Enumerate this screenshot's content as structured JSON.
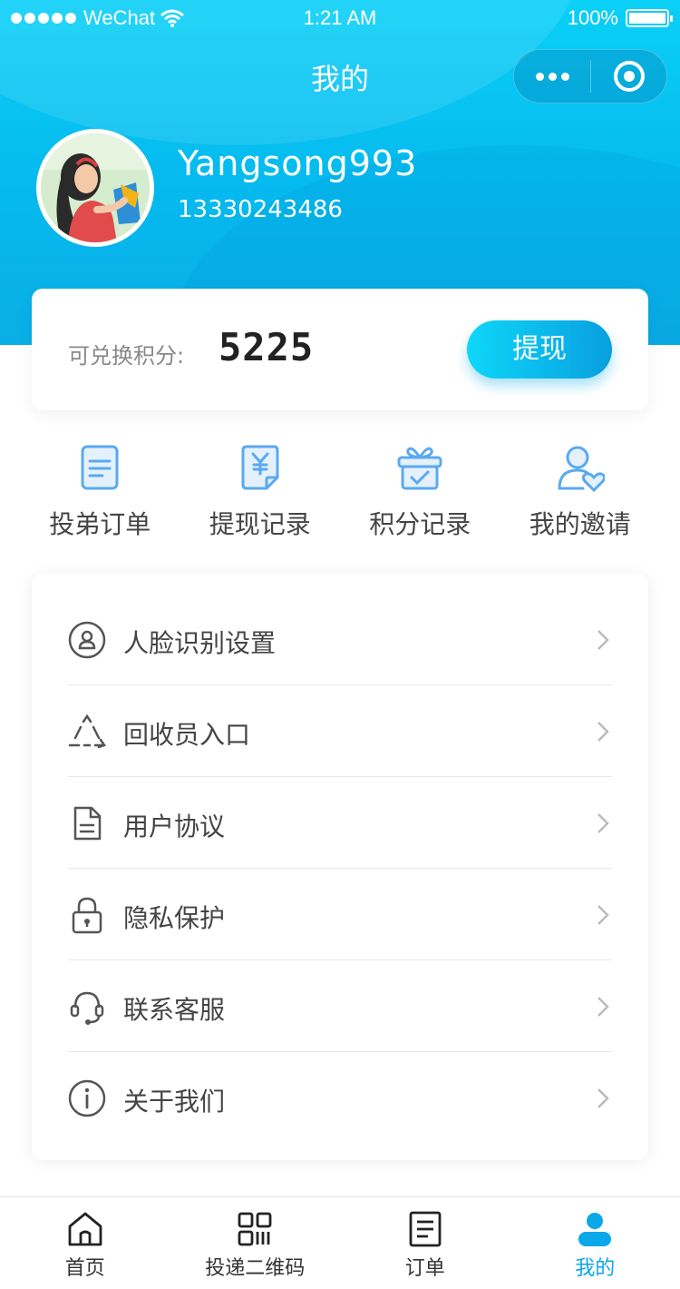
{
  "status_bar": {
    "carrier": "WeChat",
    "time": "1:21 AM",
    "battery": "100%"
  },
  "nav": {
    "title": "我的"
  },
  "profile": {
    "username": "Yangsong993",
    "phone": "13330243486"
  },
  "points": {
    "label": "可兑换积分:",
    "value": "5225",
    "button_label": "提现"
  },
  "quick_actions": [
    {
      "label": "投弟订单",
      "icon": "order-doc-icon"
    },
    {
      "label": "提现记录",
      "icon": "yen-doc-icon"
    },
    {
      "label": "积分记录",
      "icon": "gift-box-icon"
    },
    {
      "label": "我的邀请",
      "icon": "user-heart-icon"
    }
  ],
  "menu": [
    {
      "label": "人脸识别设置",
      "icon": "face-id-icon"
    },
    {
      "label": "回收员入口",
      "icon": "recycle-icon"
    },
    {
      "label": "用户协议",
      "icon": "document-icon"
    },
    {
      "label": "隐私保护",
      "icon": "lock-icon"
    },
    {
      "label": "联系客服",
      "icon": "headset-icon"
    },
    {
      "label": "关于我们",
      "icon": "info-icon"
    }
  ],
  "tabs": [
    {
      "label": "首页",
      "icon": "home-icon",
      "active": false
    },
    {
      "label": "投递二维码",
      "icon": "qr-code-icon",
      "active": false
    },
    {
      "label": "订单",
      "icon": "order-list-icon",
      "active": false
    },
    {
      "label": "我的",
      "icon": "profile-icon",
      "active": true
    }
  ],
  "colors": {
    "accent": "#0aa8e8",
    "header_top": "#0ad0f7",
    "header_bottom": "#0aaee6",
    "icon_blue": "#5aa9ee"
  }
}
